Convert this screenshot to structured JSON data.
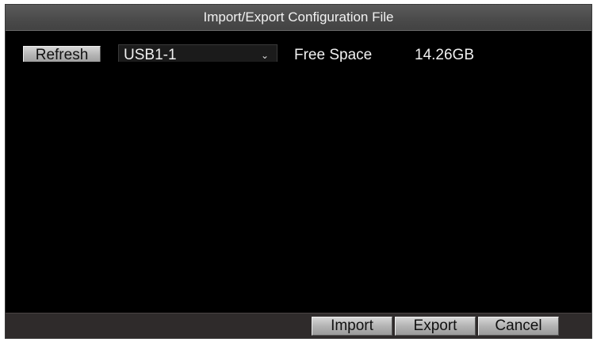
{
  "dialog": {
    "title": "Import/Export Configuration File"
  },
  "toolbar": {
    "refresh_label": "Refresh",
    "device_select": {
      "selected": "USB1-1",
      "chevron_icon": "chevron-down-icon"
    },
    "free_space_label": "Free Space",
    "free_space_value": "14.26GB"
  },
  "footer": {
    "import_label": "Import",
    "export_label": "Export",
    "cancel_label": "Cancel"
  },
  "colors": {
    "background": "#000000",
    "titlebar": "#4a4a4a",
    "footer": "#2f2b2b",
    "button_face": "#b3b3b3",
    "text": "#f0f0f0"
  }
}
